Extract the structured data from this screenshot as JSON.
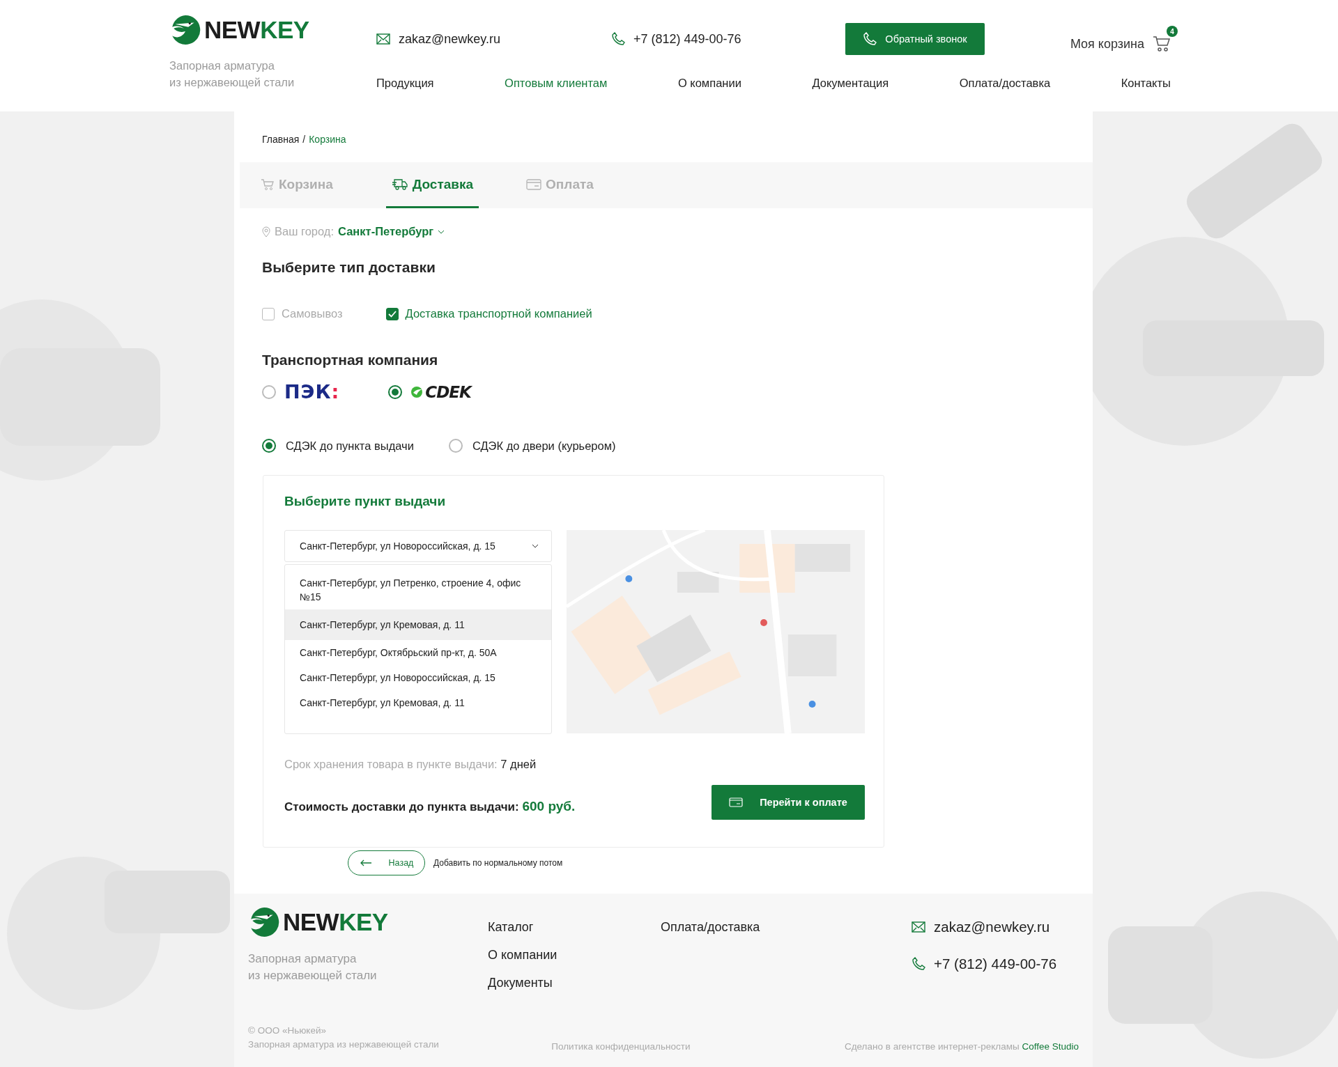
{
  "header": {
    "logo": {
      "part1": "NEW",
      "part2": "KEY"
    },
    "tagline": [
      "Запорная арматура",
      "из нержавеющей стали"
    ],
    "email": "zakaz@newkey.ru",
    "phone": "+7 (812) 449-00-76",
    "callback_button": "Обратный звонок",
    "cart": {
      "label": "Моя корзина",
      "count": "4"
    },
    "nav": [
      {
        "label": "Продукция",
        "selected": false
      },
      {
        "label": "Оптовым клиентам",
        "selected": true
      },
      {
        "label": "О компании",
        "selected": false
      },
      {
        "label": "Документация",
        "selected": false
      },
      {
        "label": "Оплата/доставка",
        "selected": false
      },
      {
        "label": "Контакты",
        "selected": false
      }
    ]
  },
  "breadcrumb": {
    "items": [
      "Главная",
      "Корзина"
    ],
    "separator": "/"
  },
  "steps": [
    {
      "kind": "cart",
      "label": "Корзина",
      "selected": false
    },
    {
      "kind": "truck",
      "label": "Доставка",
      "selected": true
    },
    {
      "kind": "card",
      "label": "Оплата",
      "selected": false
    }
  ],
  "city": {
    "label": "Ваш город:",
    "value": "Санкт-Петербург"
  },
  "delivery_type": {
    "title": "Выберите тип доставки",
    "options": [
      {
        "label": "Самовывоз",
        "checked": false
      },
      {
        "label": "Доставка транспортной компанией",
        "checked": true
      }
    ]
  },
  "carrier": {
    "title": "Транспортная компания",
    "options": [
      {
        "kind": "pek",
        "name": "ПЭК",
        "mark": ":",
        "selected": false
      },
      {
        "kind": "cdek",
        "name": "CDEK",
        "selected": true
      }
    ]
  },
  "service": [
    {
      "label": "СДЭК до пункта выдачи",
      "selected": true
    },
    {
      "label": "СДЭК до двери (курьером)",
      "selected": false
    }
  ],
  "pickup": {
    "title": "Выберите пункт выдачи",
    "select_value": "Санкт-Петербург, ул Новороссийская, д. 15",
    "options": [
      {
        "label": "Санкт-Петербург, ул Петренко, строение 4, офис №15",
        "selected": false
      },
      {
        "label": "Санкт-Петербург, ул Кремовая, д. 11",
        "selected": true
      },
      {
        "label": "Санкт-Петербург, Октябрьский пр-кт, д. 50А",
        "selected": false
      },
      {
        "label": "Санкт-Петербург, ул Новороссийская, д. 15",
        "selected": false
      },
      {
        "label": "Санкт-Петербург, ул Кремовая, д. 11",
        "selected": false
      }
    ],
    "storage_label": "Срок хранения товара в пункте выдачи:",
    "storage_value": "7 дней",
    "cost_label": "Стоимость доставки до пункта выдачи:",
    "cost_value": "600 руб.",
    "pay_button": "Перейти к оплате"
  },
  "back_button": "Назад",
  "note": "Добавить по нормальному потом",
  "footer": {
    "logo": {
      "part1": "NEW",
      "part2": "KEY"
    },
    "tagline": [
      "Запорная арматура",
      "из нержавеющей стали"
    ],
    "links_1": [
      "Каталог",
      "О компании",
      "Документы"
    ],
    "links_2": [
      "Оплата/доставка"
    ],
    "email": "zakaz@newkey.ru",
    "phone": "+7 (812) 449-00-76",
    "copyright": [
      "© ООО «Ньюкей»",
      "Запорная арматура из нержавеющей стали"
    ],
    "privacy": "Политика конфиденциальности",
    "credit": "Сделано в агентстве интернет-рекламы",
    "credit_link": "Coffee Studio"
  }
}
